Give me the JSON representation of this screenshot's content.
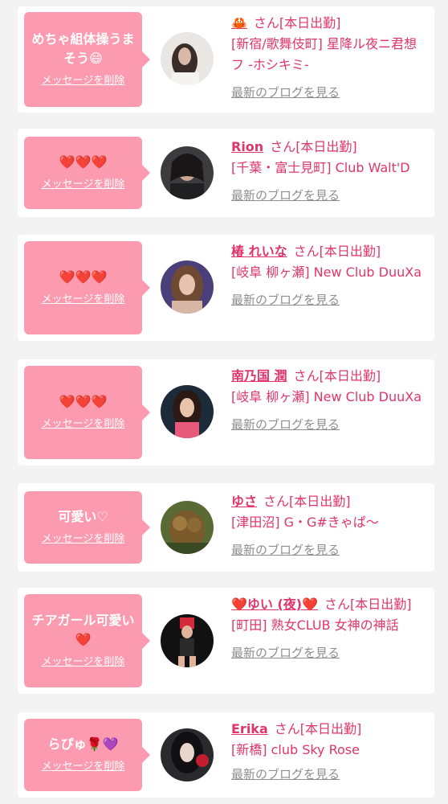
{
  "delete_label": "メッセージを削除",
  "blog_label": "最新のブログを見る",
  "accent_color": "#e0356b",
  "bubble_color": "#fc9aaf",
  "cards": [
    {
      "message": "めちゃ組体操うまそう😄",
      "name": "🦀",
      "suffix": "さん[本日出勤]",
      "shop": "[新宿/歌舞伎町] 星降ル夜ニ君想フ -ホシキミ-",
      "avatar_icon": "portrait-photo"
    },
    {
      "message": "❤️❤️❤️",
      "name": "Rion",
      "suffix": "さん[本日出勤]",
      "shop": "[千葉・富士見町] Club Walt'D",
      "avatar_icon": "portrait-photo"
    },
    {
      "message": "❤️❤️❤️",
      "name": "椿 れいな",
      "suffix": "さん[本日出勤]",
      "shop": "[岐阜 柳ヶ瀬] New Club DuuXa",
      "avatar_icon": "portrait-photo"
    },
    {
      "message": "❤️❤️❤️",
      "name": "南乃国 潤",
      "suffix": "さん[本日出勤]",
      "shop": "[岐阜 柳ヶ瀬] New Club DuuXa",
      "avatar_icon": "portrait-photo"
    },
    {
      "message": "可愛い♡",
      "name": "ゆさ",
      "suffix": "さん[本日出勤]",
      "shop": "[津田沼] G・G#きゃぱ〜",
      "avatar_icon": "portrait-photo"
    },
    {
      "message": "チアガール可愛い❤️",
      "name": "❤️ゆい (夜)❤️",
      "suffix": "さん[本日出勤]",
      "shop": "[町田] 熟女CLUB 女神の神話",
      "avatar_icon": "portrait-photo"
    },
    {
      "message": "らぴゅ🌹💜",
      "name": "Erika",
      "suffix": "さん[本日出勤]",
      "shop": "[新橋] club Sky Rose",
      "avatar_icon": "portrait-photo"
    }
  ]
}
